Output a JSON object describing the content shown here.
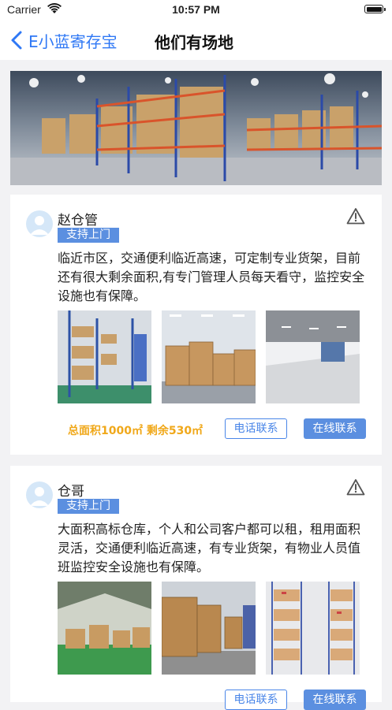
{
  "status_bar": {
    "carrier": "Carrier",
    "time": "10:57 PM"
  },
  "nav": {
    "back_label": "E小蓝寄存宝",
    "title": "他们有场地"
  },
  "listings": [
    {
      "name": "赵仓管",
      "badge": "支持上门",
      "description": "临近市区，交通便利临近高速，可定制专业货架，目前还有很大剩余面积,有专门管理人员每天看守，监控安全设施也有保障。",
      "area": "总面积1000㎡ 剩余530㎡",
      "phone_button": "电话联系",
      "online_button": "在线联系"
    },
    {
      "name": "仓哥",
      "badge": "支持上门",
      "description": "大面积高标仓库，个人和公司客户都可以租，租用面积灵活，交通便利临近高速，有专业货架，有物业人员值班监控安全设施也有保障。",
      "phone_button": "电话联系",
      "online_button": "在线联系"
    }
  ],
  "colors": {
    "accent": "#2f78f5",
    "badge": "#5b8fe0",
    "area_text": "#f0a81a"
  },
  "icons": [
    "wifi-icon",
    "battery-icon",
    "back-chevron-icon",
    "warning-icon",
    "avatar-icon"
  ]
}
